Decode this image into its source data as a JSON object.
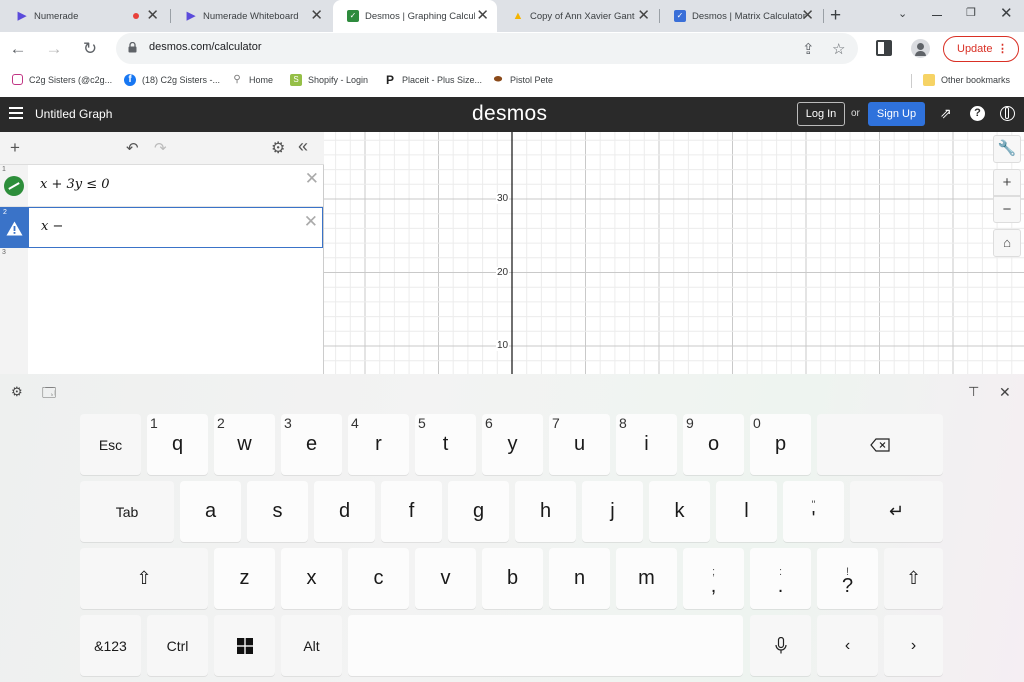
{
  "browser": {
    "tabs": [
      {
        "title": "Numerade",
        "icon": "numerade-icon"
      },
      {
        "title": "Numerade Whiteboard",
        "icon": "numerade-icon"
      },
      {
        "title": "Desmos | Graphing Calcul",
        "icon": "desmos-icon"
      },
      {
        "title": "Copy of Ann Xavier Gante",
        "icon": "drive-icon"
      },
      {
        "title": "Desmos | Matrix Calculator",
        "icon": "desmos-icon"
      }
    ],
    "new_tab_glyph": "+",
    "url": "desmos.com/calculator",
    "update_label": "Update",
    "bookmarks": [
      {
        "label": "C2g Sisters (@c2g...",
        "icon": "instagram-icon"
      },
      {
        "label": "(18) C2g Sisters -...",
        "icon": "facebook-icon"
      },
      {
        "label": "Home",
        "icon": "link-icon"
      },
      {
        "label": "Shopify - Login",
        "icon": "shopify-icon"
      },
      {
        "label": "Placeit - Plus Size...",
        "icon": "placeit-icon"
      },
      {
        "label": "Pistol Pete",
        "icon": "pete-icon"
      }
    ],
    "other_bookmarks": "Other bookmarks"
  },
  "desmos": {
    "graph_title": "Untitled Graph",
    "logo": "desmos",
    "login_label": "Log In",
    "or_label": "or",
    "signup_label": "Sign Up",
    "expressions": [
      {
        "number": "1",
        "latex": "x + 3y ≤ 0"
      },
      {
        "number": "2",
        "latex": "x −"
      },
      {
        "number": "3",
        "latex": ""
      }
    ],
    "axis": {
      "y_ticks": [
        "30",
        "20",
        "10"
      ]
    },
    "zoom_in": "+",
    "zoom_out": "−"
  },
  "keyboard": {
    "row1": [
      {
        "label": "Esc",
        "alt": ""
      },
      {
        "label": "q",
        "alt": "1"
      },
      {
        "label": "w",
        "alt": "2"
      },
      {
        "label": "e",
        "alt": "3"
      },
      {
        "label": "r",
        "alt": "4"
      },
      {
        "label": "t",
        "alt": "5"
      },
      {
        "label": "y",
        "alt": "6"
      },
      {
        "label": "u",
        "alt": "7"
      },
      {
        "label": "i",
        "alt": "8"
      },
      {
        "label": "o",
        "alt": "9"
      },
      {
        "label": "p",
        "alt": "0"
      }
    ],
    "row2": [
      {
        "label": "Tab"
      },
      {
        "label": "a"
      },
      {
        "label": "s"
      },
      {
        "label": "d"
      },
      {
        "label": "f"
      },
      {
        "label": "g"
      },
      {
        "label": "h"
      },
      {
        "label": "j"
      },
      {
        "label": "k"
      },
      {
        "label": "l"
      },
      {
        "label": "'",
        "top": "\""
      }
    ],
    "row3": [
      {
        "label": "z"
      },
      {
        "label": "x"
      },
      {
        "label": "c"
      },
      {
        "label": "v"
      },
      {
        "label": "b"
      },
      {
        "label": "n"
      },
      {
        "label": "m"
      },
      {
        "label": ",",
        "top": ";"
      },
      {
        "label": ".",
        "top": ":"
      },
      {
        "label": "?",
        "top": "!"
      }
    ],
    "row4": [
      {
        "label": "&123"
      },
      {
        "label": "Ctrl"
      },
      {
        "label": "Alt"
      }
    ]
  }
}
